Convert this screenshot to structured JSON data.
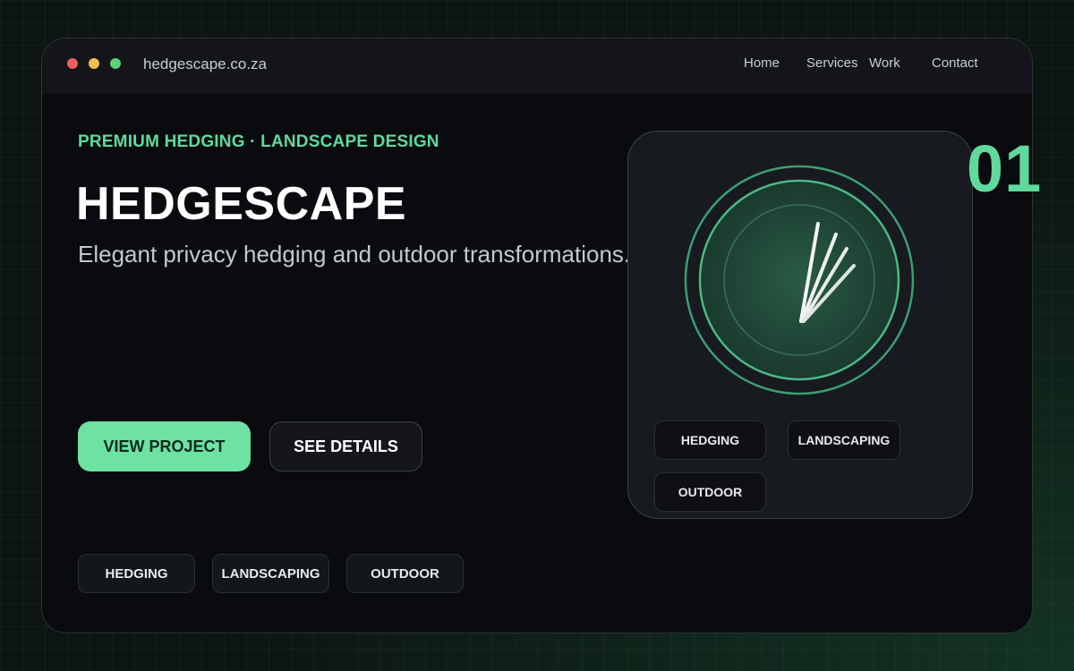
{
  "window": {
    "controls": [
      "close",
      "minimize",
      "maximize"
    ],
    "url": "hedgescape.co.za",
    "nav": [
      "Home",
      "Services",
      "Work",
      "Contact"
    ]
  },
  "hero": {
    "eyebrow": "PREMIUM HEDGING · LANDSCAPE DESIGN",
    "title": "HEDGESCAPE",
    "subtitle": "Elegant privacy hedging and outdoor transformations.",
    "primary_button": "VIEW PROJECT",
    "secondary_button": "SEE DETAILS",
    "tags": [
      "HEDGING",
      "LANDSCAPING",
      "OUTDOOR"
    ]
  },
  "card": {
    "icon": "hedge-strokes-icon",
    "tags": [
      "HEDGING",
      "LANDSCAPING",
      "OUTDOOR"
    ]
  },
  "slide_number": "01",
  "colors": {
    "accent": "#5fd99c",
    "button_primary": "#6de2a3",
    "window_bg": "#090b0f",
    "page_bg": "#0c1512"
  }
}
